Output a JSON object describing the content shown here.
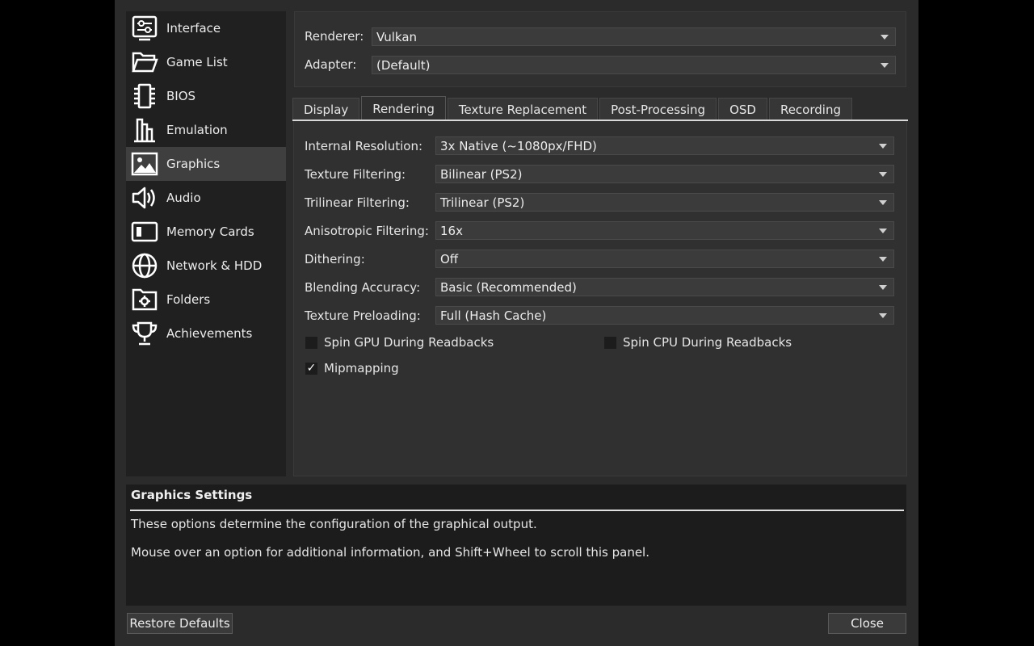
{
  "sidebar": {
    "items": [
      {
        "label": "Interface",
        "icon": "interface-icon"
      },
      {
        "label": "Game List",
        "icon": "folder-open-icon"
      },
      {
        "label": "BIOS",
        "icon": "chip-icon"
      },
      {
        "label": "Emulation",
        "icon": "emulation-icon"
      },
      {
        "label": "Graphics",
        "icon": "image-icon",
        "active": true
      },
      {
        "label": "Audio",
        "icon": "speaker-icon"
      },
      {
        "label": "Memory Cards",
        "icon": "memory-card-icon"
      },
      {
        "label": "Network & HDD",
        "icon": "globe-icon"
      },
      {
        "label": "Folders",
        "icon": "folder-gear-icon"
      },
      {
        "label": "Achievements",
        "icon": "trophy-icon"
      }
    ]
  },
  "top": {
    "renderer_label": "Renderer:",
    "renderer_value": "Vulkan",
    "adapter_label": "Adapter:",
    "adapter_value": "(Default)"
  },
  "tabs": [
    "Display",
    "Rendering",
    "Texture Replacement",
    "Post-Processing",
    "OSD",
    "Recording"
  ],
  "active_tab": "Rendering",
  "settings": [
    {
      "label": "Internal Resolution:",
      "value": "3x Native (~1080px/FHD)"
    },
    {
      "label": "Texture Filtering:",
      "value": "Bilinear (PS2)"
    },
    {
      "label": "Trilinear Filtering:",
      "value": "Trilinear (PS2)"
    },
    {
      "label": "Anisotropic Filtering:",
      "value": "16x"
    },
    {
      "label": "Dithering:",
      "value": "Off"
    },
    {
      "label": "Blending Accuracy:",
      "value": "Basic (Recommended)"
    },
    {
      "label": "Texture Preloading:",
      "value": "Full (Hash Cache)"
    }
  ],
  "checkboxes": {
    "spin_gpu": {
      "label": "Spin GPU During Readbacks",
      "checked": false
    },
    "spin_cpu": {
      "label": "Spin CPU During Readbacks",
      "checked": false
    },
    "mipmapping": {
      "label": "Mipmapping",
      "checked": true,
      "mark": "✓"
    }
  },
  "help": {
    "title": "Graphics Settings",
    "line1": "These options determine the configuration of the graphical output.",
    "line2": "Mouse over an option for additional information, and Shift+Wheel to scroll this panel."
  },
  "buttons": {
    "restore_defaults": "Restore Defaults",
    "close": "Close"
  }
}
